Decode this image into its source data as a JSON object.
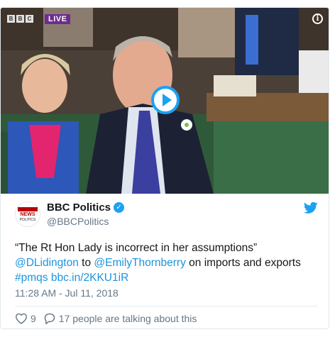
{
  "media": {
    "broadcaster_logo": [
      "B",
      "B",
      "C"
    ],
    "live_label": "LIVE",
    "info_icon": "i"
  },
  "author": {
    "avatar_top": "BBC",
    "avatar_news": "NEWS",
    "avatar_sub": "POLITICS",
    "display_name": "BBC Politics",
    "handle": "@BBCPolitics"
  },
  "tweet": {
    "quote": "“The Rt Hon Lady is incorrect in her assumptions”",
    "mention1": "@DLidington",
    "to_word": " to ",
    "mention2": "@EmilyThornberry",
    "tail": " on imports and exports",
    "hashtag": "#pmqs",
    "link": "bbc.in/2KKU1iR",
    "timestamp": "11:28 AM - Jul 11, 2018"
  },
  "actions": {
    "like_count": "9",
    "talking": "17 people are talking about this"
  },
  "colors": {
    "link": "#1b95e0",
    "play_ring": "#1da1f2",
    "live_badge": "#6e2c8f",
    "muted": "#657786"
  },
  "icons": [
    "info-icon",
    "play-icon",
    "verified-icon",
    "twitter-bird-icon",
    "heart-icon",
    "reply-bubble-icon"
  ]
}
